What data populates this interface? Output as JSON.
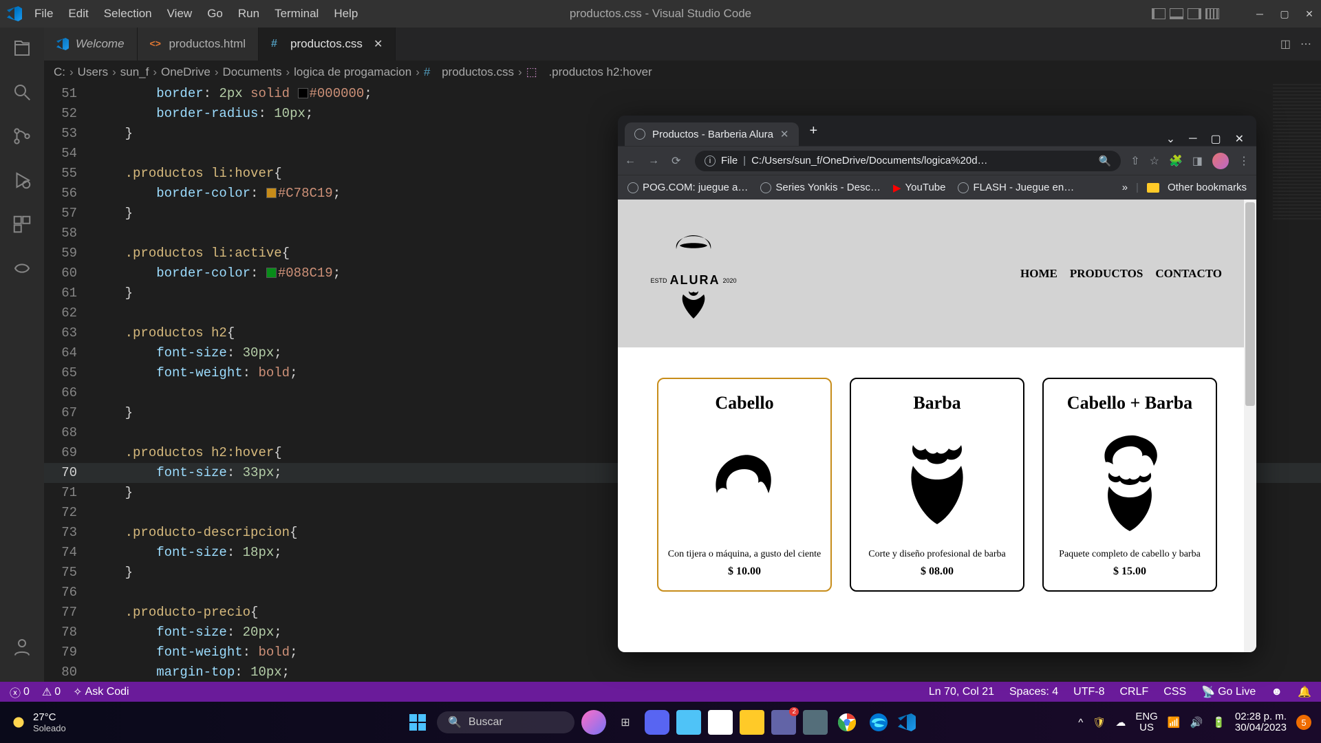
{
  "titlebar": {
    "menu": [
      "File",
      "Edit",
      "Selection",
      "View",
      "Go",
      "Run",
      "Terminal",
      "Help"
    ],
    "title": "productos.css - Visual Studio Code"
  },
  "tabs": [
    {
      "icon": "vscode",
      "label": "Welcome",
      "italic": true,
      "active": false
    },
    {
      "icon": "html",
      "label": "productos.html",
      "italic": false,
      "active": false
    },
    {
      "icon": "css",
      "label": "productos.css",
      "italic": false,
      "active": true,
      "close": true
    }
  ],
  "breadcrumb": {
    "parts": [
      "C:",
      "Users",
      "sun_f",
      "OneDrive",
      "Documents",
      "logica de progamacion"
    ],
    "file": "productos.css",
    "symbol": ".productos h2:hover"
  },
  "code": {
    "start": 51,
    "current": 70,
    "lines": [
      {
        "n": 51,
        "seg": [
          [
            "        ",
            ""
          ],
          [
            "border",
            "prop"
          ],
          [
            ": ",
            "punc"
          ],
          [
            "2px",
            "num"
          ],
          [
            " ",
            ""
          ],
          [
            "solid",
            "str"
          ],
          [
            " ",
            ""
          ],
          [
            "SW#000000",
            ""
          ],
          [
            "#000000",
            "str"
          ],
          [
            ";",
            "punc"
          ]
        ]
      },
      {
        "n": 52,
        "seg": [
          [
            "        ",
            ""
          ],
          [
            "border-radius",
            "prop"
          ],
          [
            ": ",
            "punc"
          ],
          [
            "10px",
            "num"
          ],
          [
            ";",
            "punc"
          ]
        ]
      },
      {
        "n": 53,
        "seg": [
          [
            "    ",
            ""
          ],
          [
            "}",
            "punc"
          ]
        ]
      },
      {
        "n": 54,
        "seg": [
          [
            "",
            ""
          ]
        ]
      },
      {
        "n": 55,
        "seg": [
          [
            "    ",
            ""
          ],
          [
            ".productos li:hover",
            "sel"
          ],
          [
            "{",
            "punc"
          ]
        ]
      },
      {
        "n": 56,
        "seg": [
          [
            "        ",
            ""
          ],
          [
            "border-color",
            "prop"
          ],
          [
            ": ",
            "punc"
          ],
          [
            "SW#C78C19",
            ""
          ],
          [
            "#C78C19",
            "str"
          ],
          [
            ";",
            "punc"
          ]
        ]
      },
      {
        "n": 57,
        "seg": [
          [
            "    ",
            ""
          ],
          [
            "}",
            "punc"
          ]
        ]
      },
      {
        "n": 58,
        "seg": [
          [
            "",
            ""
          ]
        ]
      },
      {
        "n": 59,
        "seg": [
          [
            "    ",
            ""
          ],
          [
            ".productos li:active",
            "sel"
          ],
          [
            "{",
            "punc"
          ]
        ]
      },
      {
        "n": 60,
        "seg": [
          [
            "        ",
            ""
          ],
          [
            "border-color",
            "prop"
          ],
          [
            ": ",
            "punc"
          ],
          [
            "SW#088C19",
            ""
          ],
          [
            "#088C19",
            "str"
          ],
          [
            ";",
            "punc"
          ]
        ]
      },
      {
        "n": 61,
        "seg": [
          [
            "    ",
            ""
          ],
          [
            "}",
            "punc"
          ]
        ]
      },
      {
        "n": 62,
        "seg": [
          [
            "",
            ""
          ]
        ]
      },
      {
        "n": 63,
        "seg": [
          [
            "    ",
            ""
          ],
          [
            ".productos h2",
            "sel"
          ],
          [
            "{",
            "punc"
          ]
        ]
      },
      {
        "n": 64,
        "seg": [
          [
            "        ",
            ""
          ],
          [
            "font-size",
            "prop"
          ],
          [
            ": ",
            "punc"
          ],
          [
            "30px",
            "num"
          ],
          [
            ";",
            "punc"
          ]
        ]
      },
      {
        "n": 65,
        "seg": [
          [
            "        ",
            ""
          ],
          [
            "font-weight",
            "prop"
          ],
          [
            ": ",
            "punc"
          ],
          [
            "bold",
            "str"
          ],
          [
            ";",
            "punc"
          ]
        ]
      },
      {
        "n": 66,
        "seg": [
          [
            "",
            ""
          ]
        ]
      },
      {
        "n": 67,
        "seg": [
          [
            "    ",
            ""
          ],
          [
            "}",
            "punc"
          ]
        ]
      },
      {
        "n": 68,
        "seg": [
          [
            "",
            ""
          ]
        ]
      },
      {
        "n": 69,
        "seg": [
          [
            "    ",
            ""
          ],
          [
            ".productos h2:hover",
            "sel"
          ],
          [
            "{",
            "punc"
          ]
        ]
      },
      {
        "n": 70,
        "seg": [
          [
            "        ",
            ""
          ],
          [
            "font-size",
            "prop"
          ],
          [
            ": ",
            "punc"
          ],
          [
            "33px",
            "num"
          ],
          [
            ";",
            "punc"
          ]
        ],
        "hl": true
      },
      {
        "n": 71,
        "seg": [
          [
            "    ",
            ""
          ],
          [
            "}",
            "punc"
          ]
        ]
      },
      {
        "n": 72,
        "seg": [
          [
            "",
            ""
          ]
        ]
      },
      {
        "n": 73,
        "seg": [
          [
            "    ",
            ""
          ],
          [
            ".producto-descripcion",
            "sel"
          ],
          [
            "{",
            "punc"
          ]
        ]
      },
      {
        "n": 74,
        "seg": [
          [
            "        ",
            ""
          ],
          [
            "font-size",
            "prop"
          ],
          [
            ": ",
            "punc"
          ],
          [
            "18px",
            "num"
          ],
          [
            ";",
            "punc"
          ]
        ]
      },
      {
        "n": 75,
        "seg": [
          [
            "    ",
            ""
          ],
          [
            "}",
            "punc"
          ]
        ]
      },
      {
        "n": 76,
        "seg": [
          [
            "",
            ""
          ]
        ]
      },
      {
        "n": 77,
        "seg": [
          [
            "    ",
            ""
          ],
          [
            ".producto-precio",
            "sel"
          ],
          [
            "{",
            "punc"
          ]
        ]
      },
      {
        "n": 78,
        "seg": [
          [
            "        ",
            ""
          ],
          [
            "font-size",
            "prop"
          ],
          [
            ": ",
            "punc"
          ],
          [
            "20px",
            "num"
          ],
          [
            ";",
            "punc"
          ]
        ]
      },
      {
        "n": 79,
        "seg": [
          [
            "        ",
            ""
          ],
          [
            "font-weight",
            "prop"
          ],
          [
            ": ",
            "punc"
          ],
          [
            "bold",
            "str"
          ],
          [
            ";",
            "punc"
          ]
        ]
      },
      {
        "n": 80,
        "seg": [
          [
            "        ",
            ""
          ],
          [
            "margin-top",
            "prop"
          ],
          [
            ": ",
            "punc"
          ],
          [
            "10px",
            "num"
          ],
          [
            ";",
            "punc"
          ]
        ]
      }
    ]
  },
  "statusbar": {
    "errors": "0",
    "warnings": "0",
    "askcodi": "Ask Codi",
    "lncol": "Ln 70, Col 21",
    "spaces": "Spaces: 4",
    "enc": "UTF-8",
    "eol": "CRLF",
    "lang": "CSS",
    "golive": "Go Live"
  },
  "browser": {
    "tab_title": "Productos - Barberia Alura",
    "url_label": "File",
    "url": "C:/Users/sun_f/OneDrive/Documents/logica%20d…",
    "bookmarks": [
      "POG.COM: juegue a…",
      "Series Yonkis - Desc…",
      "YouTube",
      "FLASH - Juegue en…"
    ],
    "other": "Other bookmarks",
    "nav": [
      "HOME",
      "PRODUCTOS",
      "CONTACTO"
    ],
    "logo_name": "ALURA",
    "logo_estd": "ESTD",
    "logo_year": "2020",
    "products": [
      {
        "title": "Cabello",
        "desc": "Con tijera o máquina, a gusto del ciente",
        "price": "$ 10.00",
        "hover": true,
        "illus": "hair"
      },
      {
        "title": "Barba",
        "desc": "Corte y diseño profesional de barba",
        "price": "$ 08.00",
        "hover": false,
        "illus": "beard"
      },
      {
        "title": "Cabello + Barba",
        "desc": "Paquete completo de cabello y barba",
        "price": "$ 15.00",
        "hover": false,
        "illus": "both"
      }
    ]
  },
  "taskbar": {
    "temp": "27°C",
    "weather": "Soleado",
    "search": "Buscar",
    "lang1": "ENG",
    "lang2": "US",
    "time": "02:28 p. m.",
    "date": "30/04/2023",
    "notif": "5",
    "teams_badge": "2"
  }
}
